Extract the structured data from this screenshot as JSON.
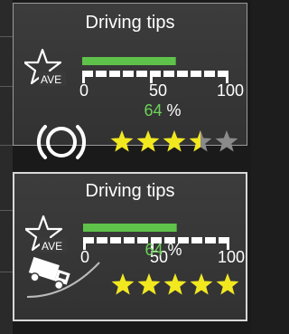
{
  "panels": [
    {
      "title": "Driving tips",
      "badge_text": "AVE",
      "gauge": {
        "min_label": "0",
        "mid_label": "50",
        "max_label": "100",
        "value": 64
      },
      "percent_value": "64",
      "percent_unit": "%",
      "category_icon": "brake-disc-icon",
      "rating": 3.5,
      "max_rating": 5
    },
    {
      "title": "Driving tips",
      "badge_text": "AVE",
      "gauge": {
        "min_label": "0",
        "mid_label": "50",
        "max_label": "100",
        "value": 64
      },
      "percent_value": "64",
      "percent_unit": "%",
      "category_icon": "truck-on-slope-icon",
      "rating": 5,
      "max_rating": 5
    }
  ],
  "colors": {
    "gauge_fill": "#5fc24a",
    "percent_text": "#6cd25a",
    "star_filled": "#f2e81e",
    "star_empty": "#8a8a8a"
  }
}
